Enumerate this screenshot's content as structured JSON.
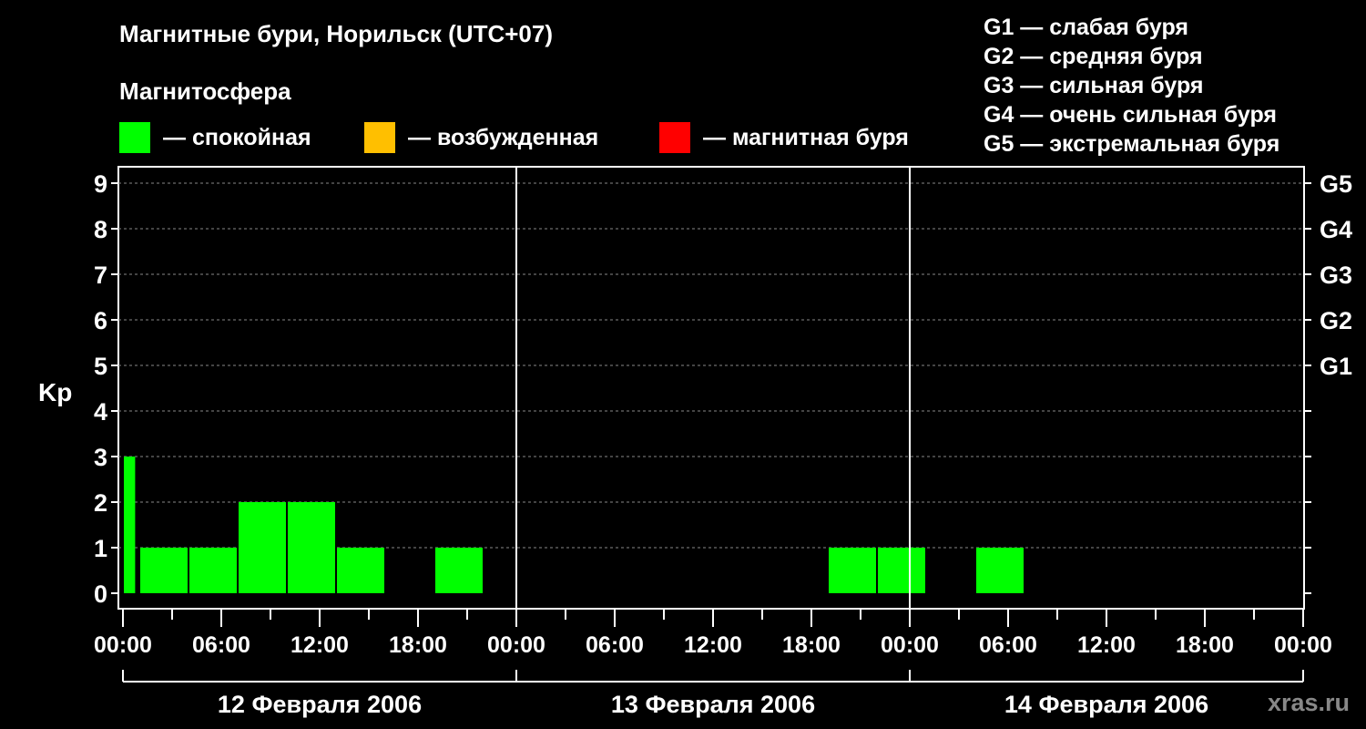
{
  "title": "Магнитные бури, Норильск (UTC+07)",
  "legend": {
    "title": "Магнитосфера",
    "items": [
      {
        "label": "— спокойная",
        "color": "#00ff00"
      },
      {
        "label": "— возбужденная",
        "color": "#ffbf00"
      },
      {
        "label": "— магнитная буря",
        "color": "#ff0000"
      }
    ]
  },
  "g_scale": [
    "G1 — слабая буря",
    "G2 — средняя буря",
    "G3 — сильная буря",
    "G4 — очень сильная буря",
    "G5 — экстремальная буря"
  ],
  "brand": "xras.ru",
  "chart_data": {
    "type": "bar",
    "ylabel": "Kp",
    "ylim": [
      0,
      9
    ],
    "y_ticks": [
      0,
      1,
      2,
      3,
      4,
      5,
      6,
      7,
      8,
      9
    ],
    "right_ticks": [
      {
        "value": 5,
        "label": "G1"
      },
      {
        "value": 6,
        "label": "G2"
      },
      {
        "value": 7,
        "label": "G3"
      },
      {
        "value": 8,
        "label": "G4"
      },
      {
        "value": 9,
        "label": "G5"
      }
    ],
    "x_unit": "hours",
    "xlim": [
      0,
      72
    ],
    "x_tick_labels": [
      "00:00",
      "06:00",
      "12:00",
      "18:00",
      "00:00",
      "06:00",
      "12:00",
      "18:00",
      "00:00",
      "06:00",
      "12:00",
      "18:00",
      "00:00"
    ],
    "days": [
      "12 Февраля 2006",
      "13 Февраля 2006",
      "14 Февраля 2006"
    ],
    "grid": true,
    "bars": [
      {
        "start": 0,
        "end": 0.8,
        "kp": 3
      },
      {
        "start": 1,
        "end": 4,
        "kp": 1
      },
      {
        "start": 4,
        "end": 7,
        "kp": 1
      },
      {
        "start": 7,
        "end": 10,
        "kp": 2
      },
      {
        "start": 10,
        "end": 13,
        "kp": 2
      },
      {
        "start": 13,
        "end": 16,
        "kp": 1
      },
      {
        "start": 19,
        "end": 22,
        "kp": 1
      },
      {
        "start": 43,
        "end": 46,
        "kp": 1
      },
      {
        "start": 46,
        "end": 49,
        "kp": 1
      },
      {
        "start": 52,
        "end": 55,
        "kp": 1
      }
    ],
    "bar_color": "#00ff00"
  }
}
